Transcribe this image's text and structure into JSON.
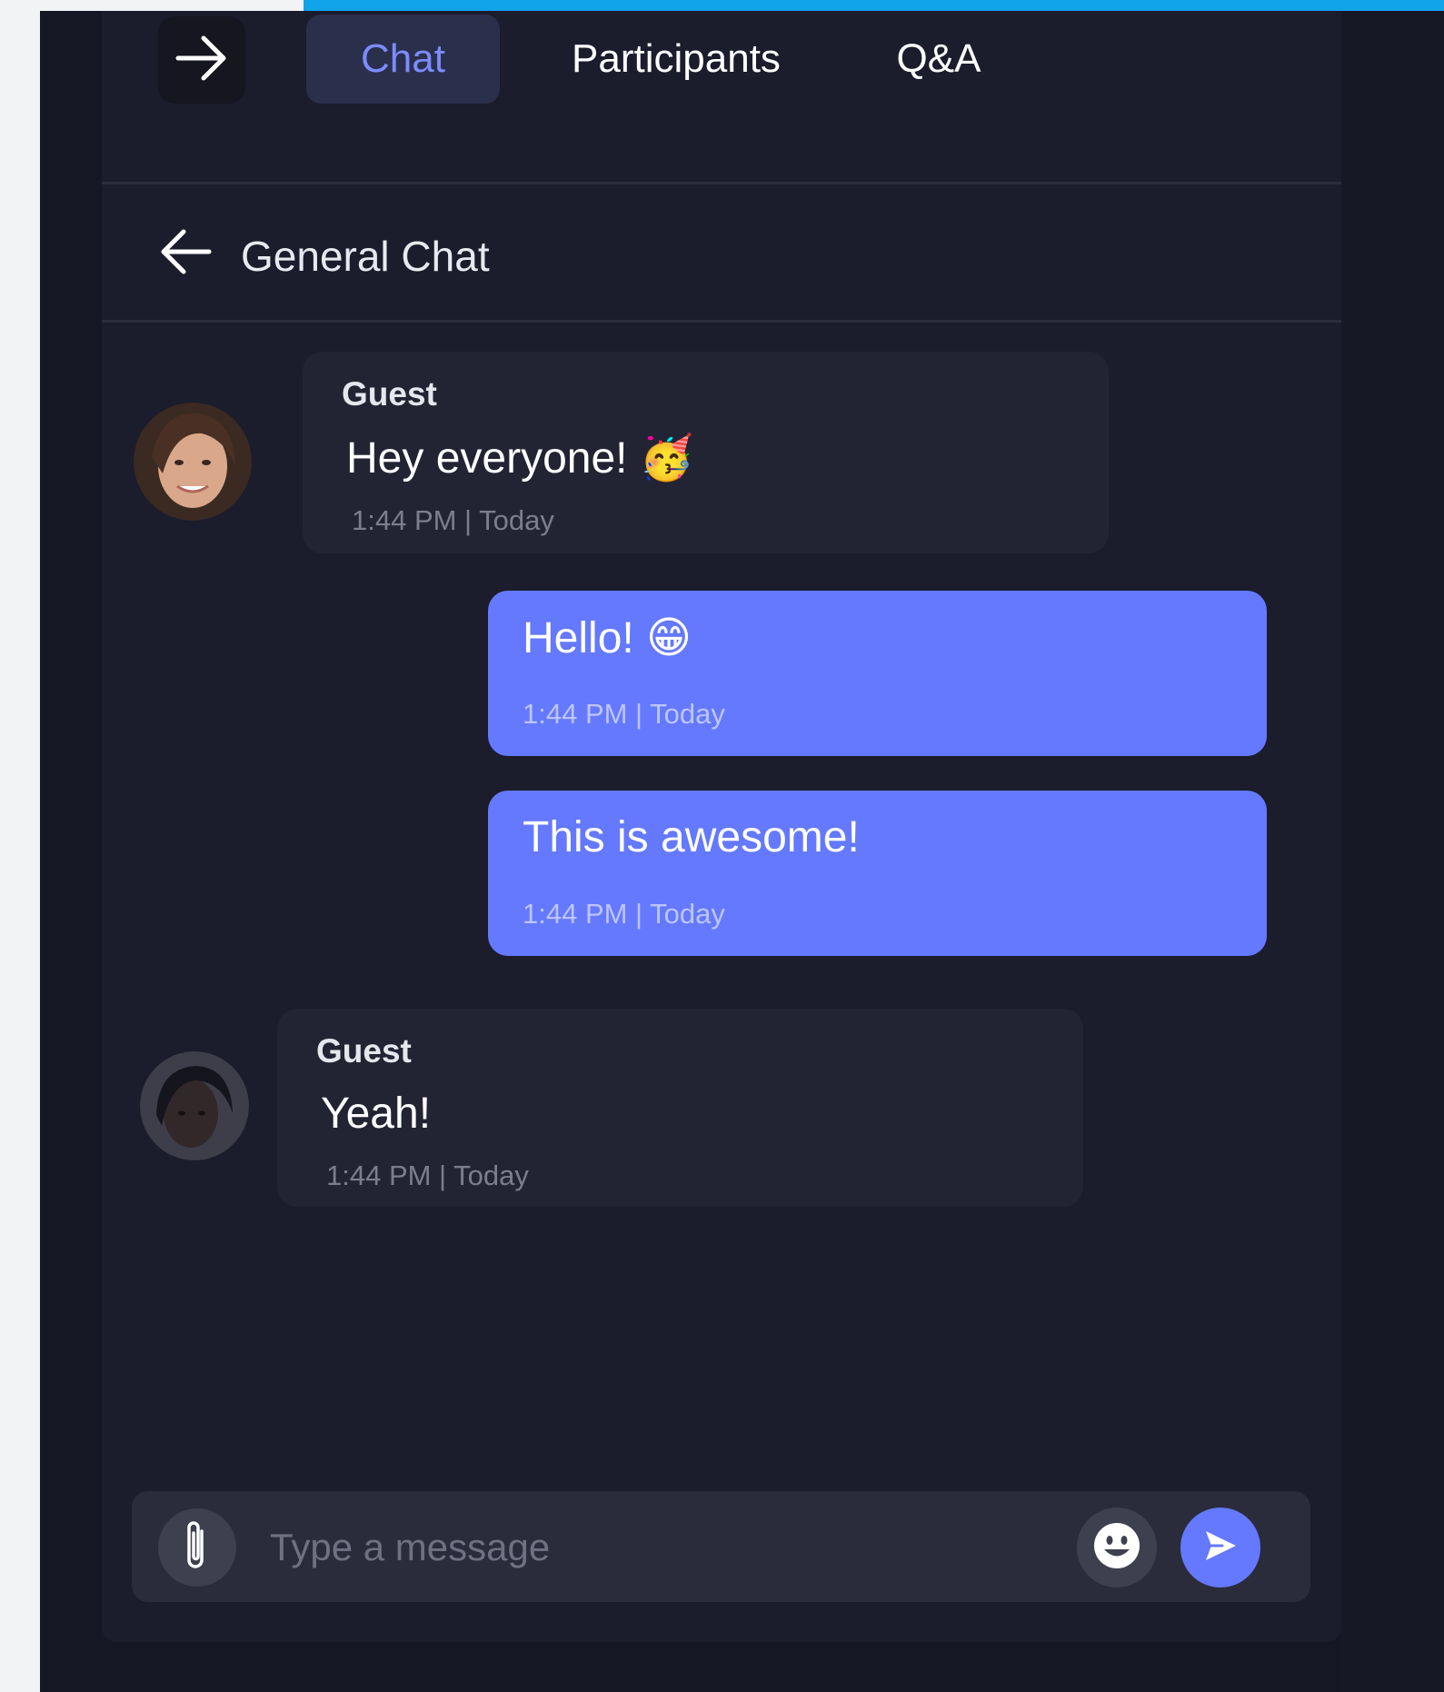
{
  "tabs": [
    {
      "label": "Chat",
      "active": true
    },
    {
      "label": "Participants",
      "active": false
    },
    {
      "label": "Q&A",
      "active": false
    }
  ],
  "icons": {
    "collapse": "arrow-right-icon",
    "back": "arrow-left-icon",
    "attach": "paperclip-icon",
    "emoji": "smiley-icon",
    "send": "send-icon"
  },
  "chat": {
    "title": "General Chat"
  },
  "messages": [
    {
      "direction": "incoming",
      "sender": "Guest",
      "text": "Hey everyone! 🥳",
      "time": "1:44 PM | Today"
    },
    {
      "direction": "outgoing",
      "text": "Hello! 😁",
      "time": "1:44 PM | Today"
    },
    {
      "direction": "outgoing",
      "text": "This is awesome!",
      "time": "1:44 PM | Today"
    },
    {
      "direction": "incoming",
      "sender": "Guest",
      "text": "Yeah!",
      "time": "1:44 PM | Today"
    }
  ],
  "composer": {
    "placeholder": "Type a message"
  },
  "colors": {
    "accent": "#6479fd",
    "top_bar": "#12a4ea",
    "panel": "#1b1c2c",
    "incoming_bubble": "#232433"
  }
}
